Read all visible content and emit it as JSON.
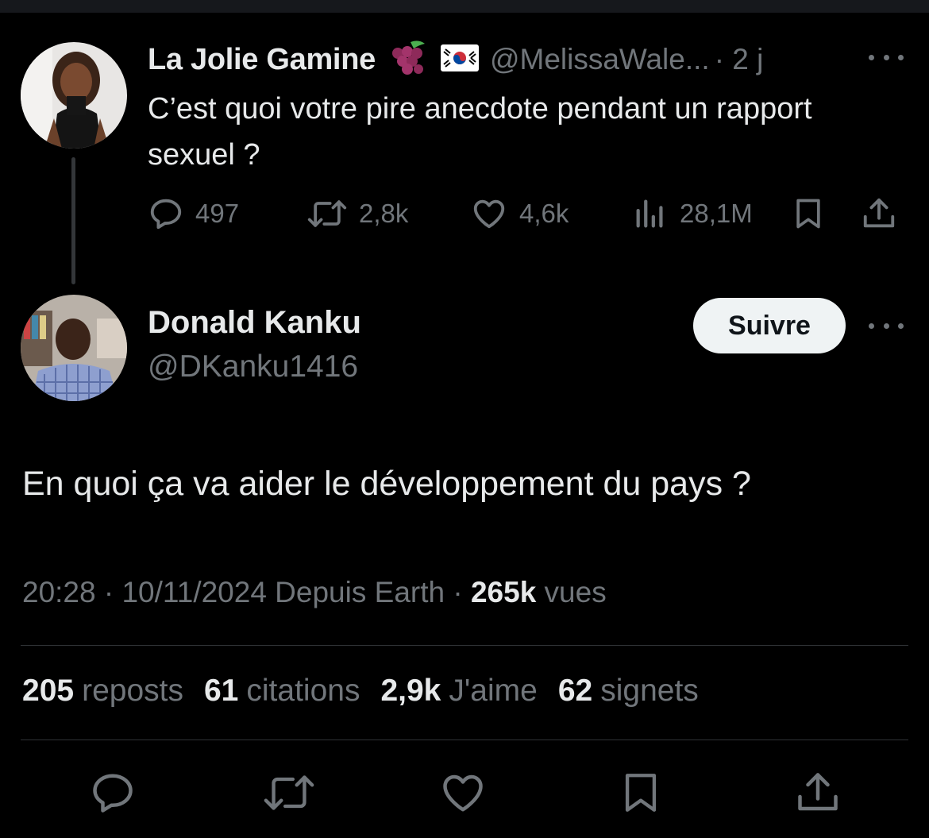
{
  "parent": {
    "name": "La Jolie Gamine",
    "handle": "@MelissaWale...",
    "time": "· 2 j",
    "text": "C’est quoi votre pire anecdote pendant un rapport sexuel ?",
    "stats": {
      "replies": "497",
      "reposts": "2,8k",
      "likes": "4,6k",
      "views": "28,1M"
    }
  },
  "reply": {
    "name": "Donald Kanku",
    "handle": "@DKanku1416",
    "follow_label": "Suivre",
    "text": "En quoi ça va aider le développement du pays ?",
    "meta_prefix": "20:28 · 10/11/2024 Depuis Earth · ",
    "views_count": "265k",
    "views_label": " vues",
    "counts": [
      {
        "value": "205",
        "label": "reposts"
      },
      {
        "value": "61",
        "label": "citations"
      },
      {
        "value": "2,9k",
        "label": "J'aime"
      },
      {
        "value": "62",
        "label": "signets"
      }
    ]
  },
  "icons": [
    "reply-icon",
    "repost-icon",
    "like-icon",
    "views-icon",
    "bookmark-icon",
    "share-icon"
  ],
  "colors": {
    "background": "#000000",
    "text": "#e7e9ea",
    "muted": "#71767b",
    "button": "#eff3f4"
  }
}
